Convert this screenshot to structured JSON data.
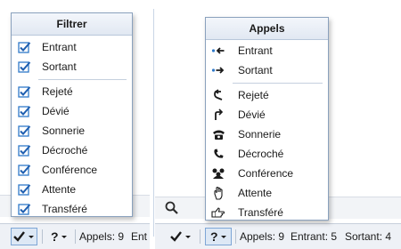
{
  "left_panel": {
    "menu": {
      "title": "Filtrer",
      "items_top": [
        {
          "label": "Entrant",
          "icon": "checkbox-checked-icon"
        },
        {
          "label": "Sortant",
          "icon": "checkbox-checked-icon"
        }
      ],
      "items_bottom": [
        {
          "label": "Rejeté",
          "icon": "checkbox-checked-icon"
        },
        {
          "label": "Dévié",
          "icon": "checkbox-checked-icon"
        },
        {
          "label": "Sonnerie",
          "icon": "checkbox-checked-icon"
        },
        {
          "label": "Décroché",
          "icon": "checkbox-checked-icon"
        },
        {
          "label": "Conférence",
          "icon": "checkbox-checked-icon"
        },
        {
          "label": "Attente",
          "icon": "checkbox-checked-icon"
        },
        {
          "label": "Transféré",
          "icon": "checkbox-checked-icon"
        }
      ]
    },
    "status": {
      "calls": "Appels: 9",
      "incoming_partial": "Ent"
    }
  },
  "right_panel": {
    "menu": {
      "title": "Appels",
      "items_top": [
        {
          "label": "Entrant",
          "icon": "incoming-arrow-icon"
        },
        {
          "label": "Sortant",
          "icon": "outgoing-arrow-icon"
        }
      ],
      "items_bottom": [
        {
          "label": "Rejeté",
          "icon": "rejected-arrow-icon"
        },
        {
          "label": "Dévié",
          "icon": "diverted-arrow-icon"
        },
        {
          "label": "Sonnerie",
          "icon": "telephone-icon"
        },
        {
          "label": "Décroché",
          "icon": "handset-icon"
        },
        {
          "label": "Conférence",
          "icon": "conference-group-icon"
        },
        {
          "label": "Attente",
          "icon": "hold-hand-icon"
        },
        {
          "label": "Transféré",
          "icon": "transfer-hand-icon"
        }
      ]
    },
    "status": {
      "calls": "Appels: 9",
      "incoming": "Entrant: 5",
      "outgoing": "Sortant: 4"
    }
  },
  "colors": {
    "accent": "#1f5fb0",
    "check": "#2f79c9"
  }
}
